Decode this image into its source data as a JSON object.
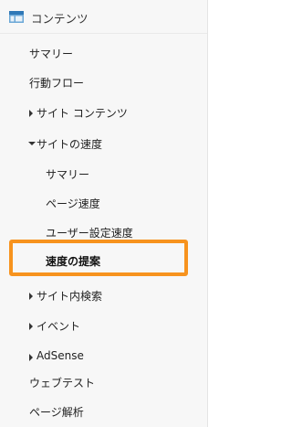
{
  "header": {
    "title": "コンテンツ",
    "icon": "content-icon"
  },
  "colors": {
    "highlight": "#f7931e",
    "panel_bg": "#f7f7f7"
  },
  "nav": {
    "summary": "サマリー",
    "behavior_flow": "行動フロー",
    "site_content": "サイト コンテンツ",
    "site_speed": "サイトの速度",
    "site_speed_items": {
      "summary": "サマリー",
      "page_timings": "ページ速度",
      "user_timings": "ユーザー設定速度",
      "speed_suggestions": "速度の提案"
    },
    "site_search": "サイト内検索",
    "events": "イベント",
    "adsense": "AdSense",
    "experiments": "ウェブテスト",
    "in_page_analytics": "ページ解析"
  }
}
